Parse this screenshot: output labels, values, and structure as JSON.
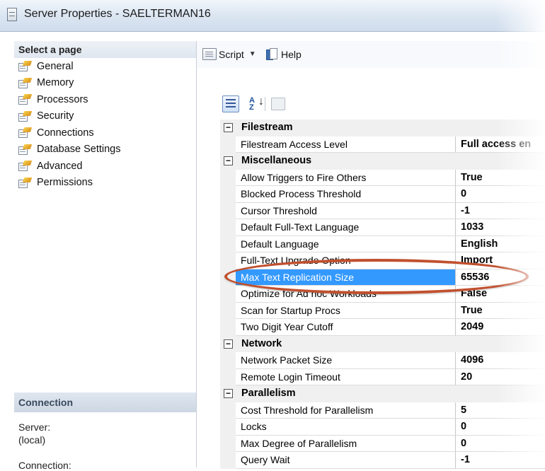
{
  "window": {
    "title": "Server Properties - SAELTERMAN16"
  },
  "left_panel": {
    "header": "Select a page",
    "pages": [
      "General",
      "Memory",
      "Processors",
      "Security",
      "Connections",
      "Database Settings",
      "Advanced",
      "Permissions"
    ],
    "connection": {
      "header": "Connection",
      "server_label": "Server:",
      "server_value": "(local)",
      "connection_label": "Connection:"
    }
  },
  "toolbar": {
    "script_label": "Script",
    "help_label": "Help"
  },
  "property_grid": {
    "categories": [
      {
        "name": "Filestream",
        "toggle": "⊟",
        "rows": [
          {
            "name": "Filestream Access Level",
            "value": "Full access en"
          }
        ]
      },
      {
        "name": "Miscellaneous",
        "toggle": "⊟",
        "rows": [
          {
            "name": "Allow Triggers to Fire Others",
            "value": "True"
          },
          {
            "name": "Blocked Process Threshold",
            "value": "0"
          },
          {
            "name": "Cursor Threshold",
            "value": "-1"
          },
          {
            "name": "Default Full-Text Language",
            "value": "1033"
          },
          {
            "name": "Default Language",
            "value": "English"
          },
          {
            "name": "Full-Text Upgrade Option",
            "value": "Import"
          },
          {
            "name": "Max Text Replication Size",
            "value": "65536",
            "selected": true
          },
          {
            "name": "Optimize for Ad hoc Workloads",
            "value": "False"
          },
          {
            "name": "Scan for Startup Procs",
            "value": "True"
          },
          {
            "name": "Two Digit Year Cutoff",
            "value": "2049"
          }
        ]
      },
      {
        "name": "Network",
        "toggle": "⊟",
        "rows": [
          {
            "name": "Network Packet Size",
            "value": "4096"
          },
          {
            "name": "Remote Login Timeout",
            "value": "20"
          }
        ]
      },
      {
        "name": "Parallelism",
        "toggle": "⊟",
        "rows": [
          {
            "name": "Cost Threshold for Parallelism",
            "value": "5"
          },
          {
            "name": "Locks",
            "value": "0"
          },
          {
            "name": "Max Degree of Parallelism",
            "value": "0"
          },
          {
            "name": "Query Wait",
            "value": "-1"
          }
        ]
      }
    ]
  },
  "colors": {
    "selection": "#3399ff",
    "highlight_ellipse": "#c1502e"
  }
}
